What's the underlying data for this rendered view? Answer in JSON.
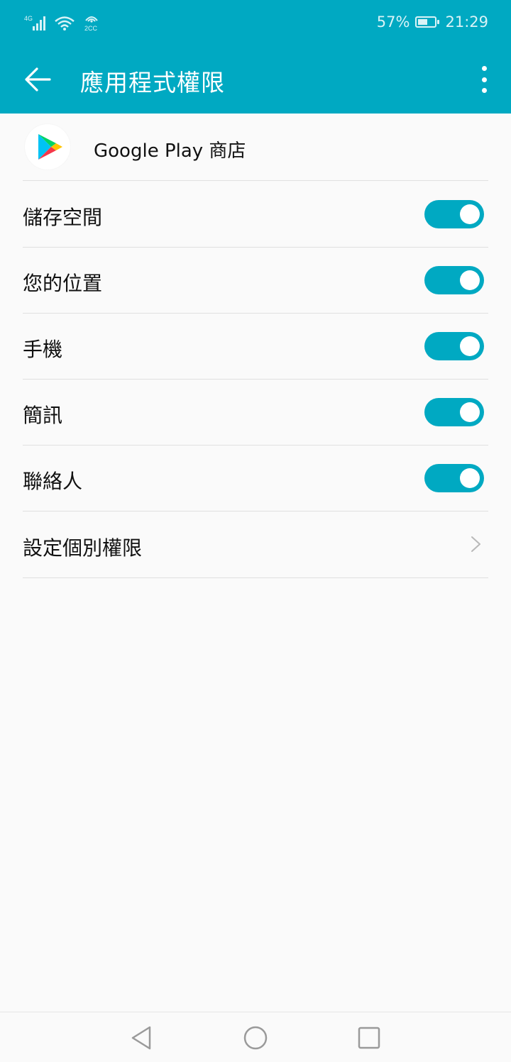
{
  "status_bar": {
    "network_label": "4G",
    "wifi_label": "2CC",
    "battery_percent_text": "57%",
    "battery_level": 0.57,
    "time": "21:29"
  },
  "app_bar": {
    "back_icon": "arrow-left-icon",
    "title": "應用程式權限",
    "more_icon": "more-vertical-icon"
  },
  "app": {
    "icon": "google-play-icon",
    "name": "Google Play 商店"
  },
  "permissions": [
    {
      "label": "儲存空間",
      "enabled": true
    },
    {
      "label": "您的位置",
      "enabled": true
    },
    {
      "label": "手機",
      "enabled": true
    },
    {
      "label": "簡訊",
      "enabled": true
    },
    {
      "label": "聯絡人",
      "enabled": true
    }
  ],
  "individual_permissions": {
    "label": "設定個別權限",
    "icon": "chevron-right-icon"
  },
  "nav_bar": {
    "back_icon": "triangle-back-icon",
    "home_icon": "circle-home-icon",
    "recents_icon": "square-recents-icon"
  },
  "colors": {
    "accent": "#00a9c2",
    "background": "#fafafa",
    "divider": "#e0e0e0"
  }
}
